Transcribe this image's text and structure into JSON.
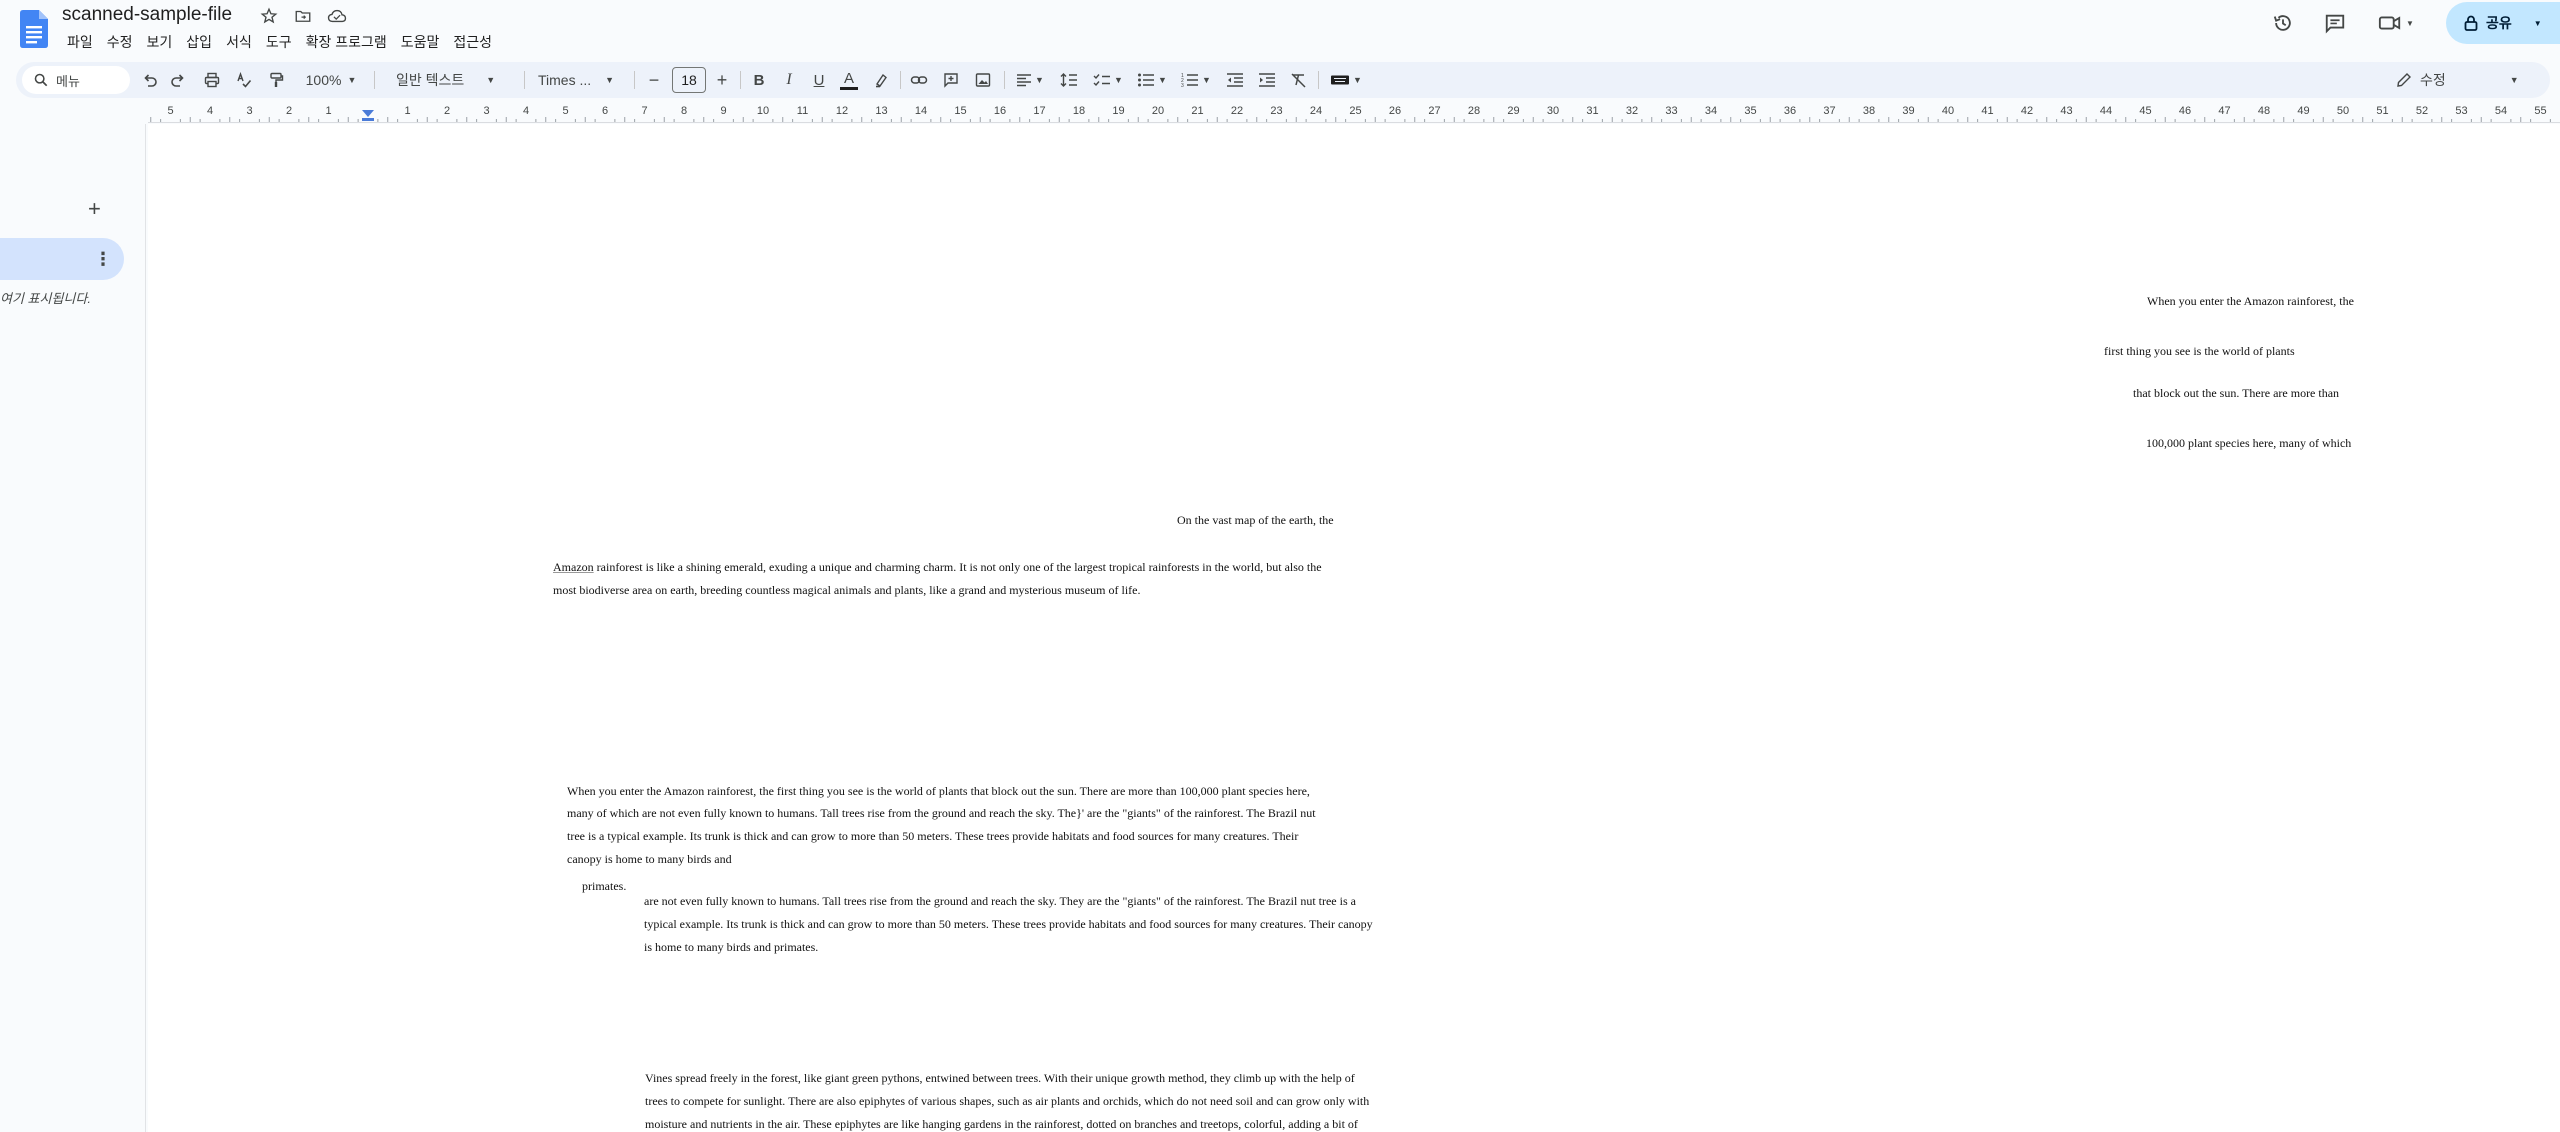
{
  "app": {
    "title": "scanned-sample-file",
    "menu": [
      "파일",
      "수정",
      "보기",
      "삽입",
      "서식",
      "도구",
      "확장 프로그램",
      "도움말",
      "접근성"
    ],
    "share_label": "공유",
    "colors": {
      "accent": "#c2e7ff",
      "doc_blue": "#4285f4",
      "toolbar_bg": "#edf2fa"
    }
  },
  "toolbar": {
    "search_placeholder": "메뉴",
    "zoom": "100%",
    "style": "일반 텍스트",
    "font": "Times ...",
    "font_size": "18",
    "mode": "수정"
  },
  "ruler": {
    "left_ticks": [
      "5",
      "4",
      "3",
      "2",
      "1"
    ],
    "right_ticks": [
      "1",
      "2",
      "3",
      "4",
      "5",
      "6",
      "7",
      "8",
      "9",
      "10",
      "11",
      "12",
      "13",
      "14",
      "15",
      "16",
      "17",
      "18",
      "19",
      "20",
      "21",
      "22",
      "23",
      "24",
      "25",
      "26",
      "27",
      "28",
      "29",
      "30",
      "31",
      "32",
      "33",
      "34",
      "35",
      "36",
      "37",
      "38",
      "39",
      "40",
      "41",
      "42",
      "43",
      "44",
      "45",
      "46",
      "47",
      "48",
      "49",
      "50",
      "51",
      "52",
      "53",
      "54",
      "55"
    ]
  },
  "sidebar": {
    "hint": "여기 표시됩니다."
  },
  "document": {
    "top_right": [
      "When you enter the Amazon rainforest, the",
      "first thing you see is the world of plants",
      "that block out the sun. There are more than",
      "100,000 plant species here, many of which"
    ],
    "center_line": "On the vast map of the earth, the",
    "intro_word": "Amazon",
    "intro_line1_rest": " rainforest is like a shining  emerald, exuding a unique and charming  charm. It is not only one of the largest  tropical rainforests in the world, but also  the",
    "intro_line2": "most biodiverse area on earth, breeding  countless magical animals and plants, like  a grand and mysterious museum of life.",
    "para1": [
      "When you enter the Amazon rainforest, the  first thing you see is the world of plants  that block out the sun. There are more than 100,000 plant species here,",
      " many of which  are not even fully known to humans. Tall  trees rise from the ground and reach the  sky. The}' are the \"giants\" of the rainforest.  The Brazil nut",
      " tree is a typical example. Its  trunk is thick and can grow to more than  50 meters. These trees provide habitats  and food sources for many creatures. Their",
      " canopy is home to many birds and"
    ],
    "para1_tail": "primates.",
    "para2": [
      "are not even fully known to humans. Tall  trees rise from the ground and reach the  sky. They are the \"giants\" of the rainforest.  The Brazil nut tree is a",
      " typical example. Its  trunk is thick and can grow to more than  50 meters. These trees provide habitats  and food sources for many creatures. Their  canopy",
      " is home to many birds and  primates."
    ],
    "para3": [
      "Vines spread freely in the forest, like giant green pythons, entwined between trees. With their unique growth method, they climb up with the help of",
      "trees to compete for sunlight. There are also epiphytes of various shapes, such as air plants and orchids, which do not need soil and can grow only with",
      "moisture and nutrients in the air. These epiphytes are like hanging gardens in the rainforest, dotted on branches and treetops, colorful, adding a bit of"
    ]
  }
}
